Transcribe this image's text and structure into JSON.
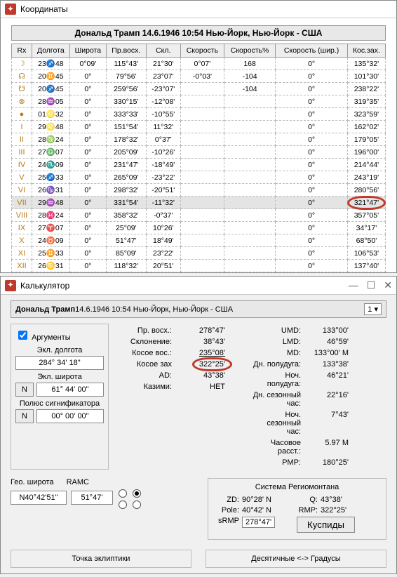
{
  "coords_window": {
    "title": "Координаты",
    "banner": "Дональд Трамп 14.6.1946 10:54 Нью-Йорк, Нью-Йорк - США",
    "cols": [
      "Rx",
      "Долгота",
      "Широта",
      "Пр.восх.",
      "Скл.",
      "Скорость",
      "Скорость%",
      "Скорость (шир.)",
      "Кос.зах."
    ],
    "rows": [
      {
        "sym": "☽",
        "lng": "23♐48",
        "lat": "0°09'",
        "ra": "115°43'",
        "dec": "21°30'",
        "spd": "0°07'",
        "spdp": "168",
        "lsp": "0°",
        "kz": "135°32'"
      },
      {
        "sym": "☊",
        "lng": "20♊45",
        "lat": "0°",
        "ra": "79°56'",
        "dec": "23°07'",
        "spd": "-0°03'",
        "spdp": "-104",
        "lsp": "0°",
        "kz": "101°30'"
      },
      {
        "sym": "☋",
        "lng": "20♐45",
        "lat": "0°",
        "ra": "259°56'",
        "dec": "-23°07'",
        "spd": "",
        "spdp": "-104",
        "lsp": "0°",
        "kz": "238°22'"
      },
      {
        "sym": "⊗",
        "lng": "28♒05",
        "lat": "0°",
        "ra": "330°15'",
        "dec": "-12°08'",
        "spd": "",
        "spdp": "",
        "lsp": "0°",
        "kz": "319°35'"
      },
      {
        "sym": "●",
        "lng": "01♌32",
        "lat": "0°",
        "ra": "333°33'",
        "dec": "-10°55'",
        "spd": "",
        "spdp": "",
        "lsp": "0°",
        "kz": "323°59'"
      },
      {
        "sym": "I",
        "lng": "29♌48",
        "lat": "0°",
        "ra": "151°54'",
        "dec": "11°32'",
        "spd": "",
        "spdp": "",
        "lsp": "0°",
        "kz": "162°02'"
      },
      {
        "sym": "II",
        "lng": "28♍24",
        "lat": "0°",
        "ra": "178°32'",
        "dec": "0°37'",
        "spd": "",
        "spdp": "",
        "lsp": "0°",
        "kz": "179°05'"
      },
      {
        "sym": "III",
        "lng": "27♎07",
        "lat": "0°",
        "ra": "205°09'",
        "dec": "-10°26'",
        "spd": "",
        "spdp": "",
        "lsp": "0°",
        "kz": "196°00'"
      },
      {
        "sym": "IV",
        "lng": "24♏09",
        "lat": "0°",
        "ra": "231°47'",
        "dec": "-18°49'",
        "spd": "",
        "spdp": "",
        "lsp": "0°",
        "kz": "214°44'"
      },
      {
        "sym": "V",
        "lng": "25♐33",
        "lat": "0°",
        "ra": "265°09'",
        "dec": "-23°22'",
        "spd": "",
        "spdp": "",
        "lsp": "0°",
        "kz": "243°19'"
      },
      {
        "sym": "VI",
        "lng": "26♑31",
        "lat": "0°",
        "ra": "298°32'",
        "dec": "-20°51'",
        "spd": "",
        "spdp": "",
        "lsp": "0°",
        "kz": "280°56'"
      },
      {
        "sym": "VII",
        "lng": "29♒48",
        "lat": "0°",
        "ra": "331°54'",
        "dec": "-11°32'",
        "spd": "",
        "spdp": "",
        "lsp": "0°",
        "kz": "321°47'",
        "select": true,
        "circle": true
      },
      {
        "sym": "VIII",
        "lng": "28♓24",
        "lat": "0°",
        "ra": "358°32'",
        "dec": "-0°37'",
        "spd": "",
        "spdp": "",
        "lsp": "0°",
        "kz": "357°05'"
      },
      {
        "sym": "IX",
        "lng": "27♈07",
        "lat": "0°",
        "ra": "25°09'",
        "dec": "10°26'",
        "spd": "",
        "spdp": "",
        "lsp": "0°",
        "kz": "34°17'"
      },
      {
        "sym": "X",
        "lng": "24♉09",
        "lat": "0°",
        "ra": "51°47'",
        "dec": "18°49'",
        "spd": "",
        "spdp": "",
        "lsp": "0°",
        "kz": "68°50'"
      },
      {
        "sym": "XI",
        "lng": "25♊33",
        "lat": "0°",
        "ra": "85°09'",
        "dec": "23°22'",
        "spd": "",
        "spdp": "",
        "lsp": "0°",
        "kz": "106°53'"
      },
      {
        "sym": "XII",
        "lng": "26♋31",
        "lat": "0°",
        "ra": "118°32'",
        "dec": "20°51'",
        "spd": "",
        "spdp": "",
        "lsp": "0°",
        "kz": "137°40'"
      }
    ]
  },
  "calc_window": {
    "title": "Калькулятор",
    "banner_bold": "Дональд Трамп",
    "banner_rest": " 14.6.1946 10:54 Нью-Йорк, Нью-Йорк - США",
    "dropdown": "1 ▾",
    "args": {
      "checkbox": "Аргументы",
      "lbl_ecl_lng": "Экл. долгота",
      "val_ecl_lng": "284° 34' 18\"",
      "lbl_ecl_lat": "Экл. широта",
      "btn_n": "N",
      "val_ecl_lat": "61° 44' 00\"",
      "lbl_pole": "Полюс сигнификатора",
      "val_pole": "00° 00' 00\""
    },
    "mid": {
      "l1k": "Пр. восх.:",
      "l1v": "278°47'",
      "l2k": "Склонение:",
      "l2v": "38°43'",
      "l3k": "Косое вос.:",
      "l3v": "235°08'",
      "l4k": "Косое зах",
      "l4v": "322°25'",
      "l5k": "AD:",
      "l5v": "43°38'",
      "l6k": "Казими:",
      "l6v": "НЕТ"
    },
    "right": {
      "l1k": "UMD:",
      "l1v": "133°00'",
      "l2k": "LMD:",
      "l2v": "46°59'",
      "l3k": "MD:",
      "l3v": "133°00' M",
      "l4k": "Дн. полудуга:",
      "l4v": "133°38'",
      "l5k": "Ноч. полудуга:",
      "l5v": "46°21'",
      "l6k": "Дн. сезонный час:",
      "l6v": "22°16'",
      "l7k": "Ноч. сезонный час:",
      "l7v": "7°43'",
      "l8k": "Часовое расст.:",
      "l8v": "5.97 M",
      "l9k": "PMP:",
      "l9v": "180°25'"
    },
    "geo": {
      "hdr1": "Гео. широта",
      "hdr2": "RAMC",
      "v1": "N40°42'51\"",
      "v2": "51°47'"
    },
    "regio": {
      "title": "Система Региомонтана",
      "zd_k": "ZD:",
      "zd_v": "90°28' N",
      "q_k": "Q:",
      "q_v": "43°38'",
      "pole_k": "Pole:",
      "pole_v": "40°42' N",
      "rmp_k": "RMP:",
      "rmp_v": "322°25'",
      "srmp_k": "sRMP",
      "srmp_v": "278°47'",
      "btn": "Куспиды"
    },
    "bottom": {
      "b1": "Точка эклиптики",
      "b2": "Десятичные <-> Градусы"
    }
  }
}
